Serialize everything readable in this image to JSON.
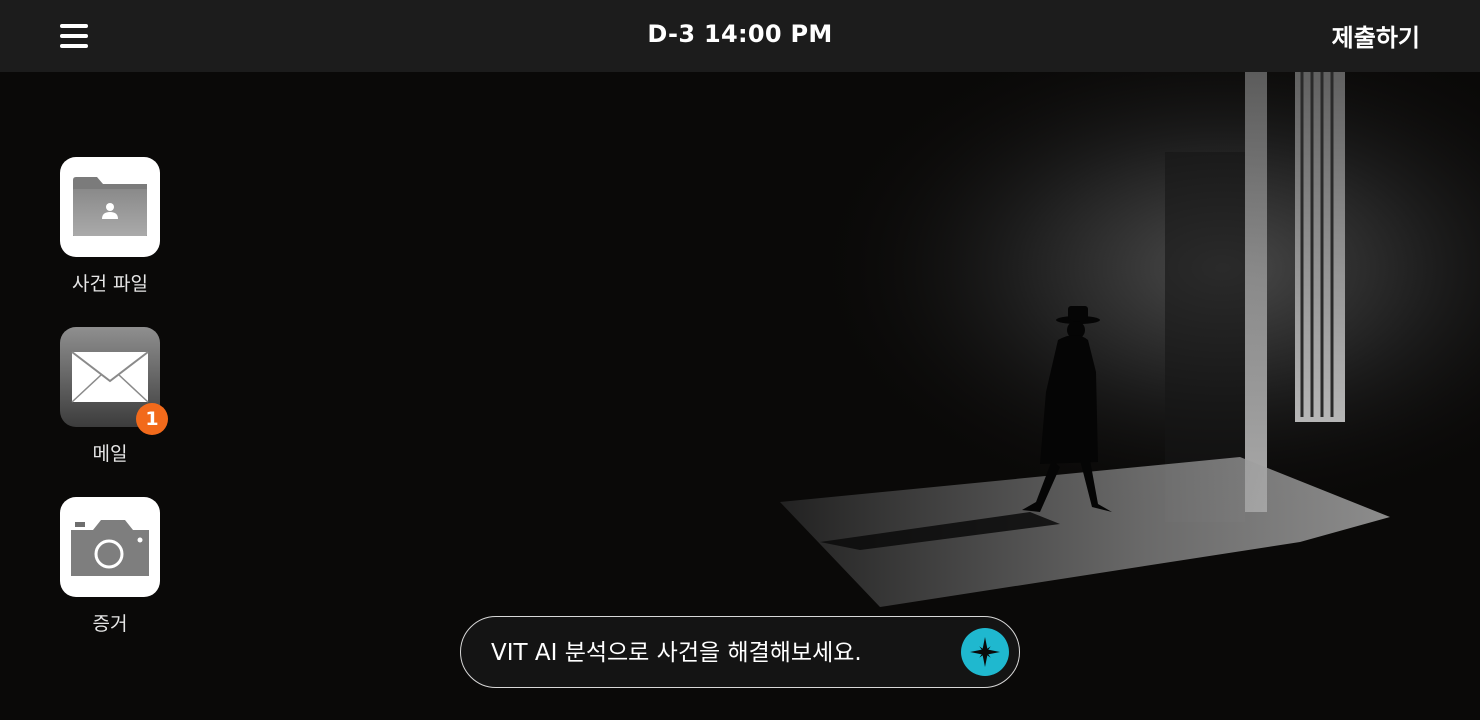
{
  "header": {
    "menu_icon": "hamburger-icon",
    "clock": "D-3 14:00 PM",
    "submit_label": "제출하기"
  },
  "desktop": {
    "apps": [
      {
        "id": "case-files",
        "label": "사건 파일",
        "icon": "folder-person-icon"
      },
      {
        "id": "mail",
        "label": "메일",
        "icon": "envelope-icon",
        "badge": "1"
      },
      {
        "id": "evidence",
        "label": "증거",
        "icon": "camera-icon"
      }
    ]
  },
  "ai_bar": {
    "placeholder": "VIT AI 분석으로 사건을 해결해보세요.",
    "button_icon": "sparkle-icon",
    "accent": "#1fb8cf"
  },
  "colors": {
    "topbar": "#1c1c1c",
    "background": "#0a0908",
    "badge": "#f26a1b"
  }
}
